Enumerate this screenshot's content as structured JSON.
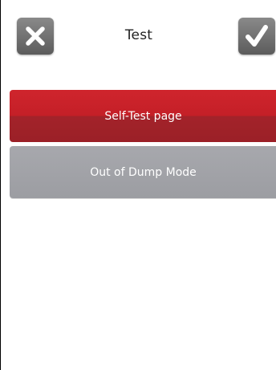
{
  "header": {
    "title": "Test",
    "cancel_icon": "close-icon",
    "confirm_icon": "check-icon"
  },
  "menu": {
    "items": [
      {
        "label": "Self-Test page",
        "selected": true
      },
      {
        "label": "Out of Dump Mode",
        "selected": false
      }
    ]
  },
  "colors": {
    "selected": "#c41f27",
    "normal": "#a1a2a7",
    "icon_button": "#737373"
  }
}
